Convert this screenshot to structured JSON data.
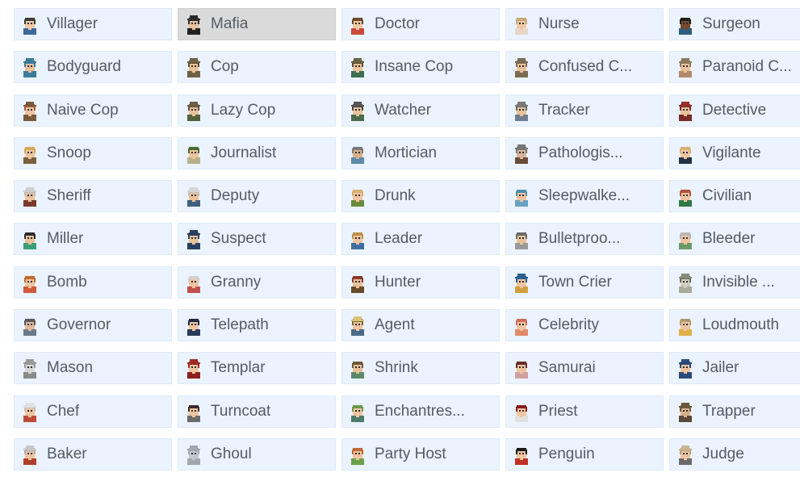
{
  "roles": [
    {
      "label": "Villager",
      "icon": "villager-avatar-icon",
      "selected": false
    },
    {
      "label": "Mafia",
      "icon": "mafia-avatar-icon",
      "selected": true
    },
    {
      "label": "Doctor",
      "icon": "doctor-avatar-icon",
      "selected": false
    },
    {
      "label": "Nurse",
      "icon": "nurse-avatar-icon",
      "selected": false
    },
    {
      "label": "Surgeon",
      "icon": "surgeon-avatar-icon",
      "selected": false
    },
    {
      "label": "Bodyguard",
      "icon": "bodyguard-avatar-icon",
      "selected": false
    },
    {
      "label": "Cop",
      "icon": "cop-avatar-icon",
      "selected": false
    },
    {
      "label": "Insane Cop",
      "icon": "insane-cop-avatar-icon",
      "selected": false
    },
    {
      "label": "Confused C...",
      "icon": "confused-cop-avatar-icon",
      "selected": false
    },
    {
      "label": "Paranoid C...",
      "icon": "paranoid-cop-avatar-icon",
      "selected": false
    },
    {
      "label": "Naive Cop",
      "icon": "naive-cop-avatar-icon",
      "selected": false
    },
    {
      "label": "Lazy Cop",
      "icon": "lazy-cop-avatar-icon",
      "selected": false
    },
    {
      "label": "Watcher",
      "icon": "watcher-avatar-icon",
      "selected": false
    },
    {
      "label": "Tracker",
      "icon": "tracker-avatar-icon",
      "selected": false
    },
    {
      "label": "Detective",
      "icon": "detective-avatar-icon",
      "selected": false
    },
    {
      "label": "Snoop",
      "icon": "snoop-avatar-icon",
      "selected": false
    },
    {
      "label": "Journalist",
      "icon": "journalist-avatar-icon",
      "selected": false
    },
    {
      "label": "Mortician",
      "icon": "mortician-avatar-icon",
      "selected": false
    },
    {
      "label": "Pathologis...",
      "icon": "pathologist-avatar-icon",
      "selected": false
    },
    {
      "label": "Vigilante",
      "icon": "vigilante-avatar-icon",
      "selected": false
    },
    {
      "label": "Sheriff",
      "icon": "sheriff-avatar-icon",
      "selected": false
    },
    {
      "label": "Deputy",
      "icon": "deputy-avatar-icon",
      "selected": false
    },
    {
      "label": "Drunk",
      "icon": "drunk-avatar-icon",
      "selected": false
    },
    {
      "label": "Sleepwalke...",
      "icon": "sleepwalker-avatar-icon",
      "selected": false
    },
    {
      "label": "Civilian",
      "icon": "civilian-avatar-icon",
      "selected": false
    },
    {
      "label": "Miller",
      "icon": "miller-avatar-icon",
      "selected": false
    },
    {
      "label": "Suspect",
      "icon": "suspect-avatar-icon",
      "selected": false
    },
    {
      "label": "Leader",
      "icon": "leader-avatar-icon",
      "selected": false
    },
    {
      "label": "Bulletproo...",
      "icon": "bulletproof-avatar-icon",
      "selected": false
    },
    {
      "label": "Bleeder",
      "icon": "bleeder-avatar-icon",
      "selected": false
    },
    {
      "label": "Bomb",
      "icon": "bomb-avatar-icon",
      "selected": false
    },
    {
      "label": "Granny",
      "icon": "granny-avatar-icon",
      "selected": false
    },
    {
      "label": "Hunter",
      "icon": "hunter-avatar-icon",
      "selected": false
    },
    {
      "label": "Town Crier",
      "icon": "town-crier-avatar-icon",
      "selected": false
    },
    {
      "label": "Invisible ...",
      "icon": "invisible-avatar-icon",
      "selected": false
    },
    {
      "label": "Governor",
      "icon": "governor-avatar-icon",
      "selected": false
    },
    {
      "label": "Telepath",
      "icon": "telepath-avatar-icon",
      "selected": false
    },
    {
      "label": "Agent",
      "icon": "agent-avatar-icon",
      "selected": false
    },
    {
      "label": "Celebrity",
      "icon": "celebrity-avatar-icon",
      "selected": false
    },
    {
      "label": "Loudmouth",
      "icon": "loudmouth-avatar-icon",
      "selected": false
    },
    {
      "label": "Mason",
      "icon": "mason-avatar-icon",
      "selected": false
    },
    {
      "label": "Templar",
      "icon": "templar-avatar-icon",
      "selected": false
    },
    {
      "label": "Shrink",
      "icon": "shrink-avatar-icon",
      "selected": false
    },
    {
      "label": "Samurai",
      "icon": "samurai-avatar-icon",
      "selected": false
    },
    {
      "label": "Jailer",
      "icon": "jailer-avatar-icon",
      "selected": false
    },
    {
      "label": "Chef",
      "icon": "chef-avatar-icon",
      "selected": false
    },
    {
      "label": "Turncoat",
      "icon": "turncoat-avatar-icon",
      "selected": false
    },
    {
      "label": "Enchantres...",
      "icon": "enchantress-avatar-icon",
      "selected": false
    },
    {
      "label": "Priest",
      "icon": "priest-avatar-icon",
      "selected": false
    },
    {
      "label": "Trapper",
      "icon": "trapper-avatar-icon",
      "selected": false
    },
    {
      "label": "Baker",
      "icon": "baker-avatar-icon",
      "selected": false
    },
    {
      "label": "Ghoul",
      "icon": "ghoul-avatar-icon",
      "selected": false
    },
    {
      "label": "Party Host",
      "icon": "party-host-avatar-icon",
      "selected": false
    },
    {
      "label": "Penguin",
      "icon": "penguin-avatar-icon",
      "selected": false
    },
    {
      "label": "Judge",
      "icon": "judge-avatar-icon",
      "selected": false
    }
  ],
  "colors": {
    "card_background": "#eaf3ff",
    "card_selected_background": "#dadada",
    "label_text": "#555b63"
  }
}
